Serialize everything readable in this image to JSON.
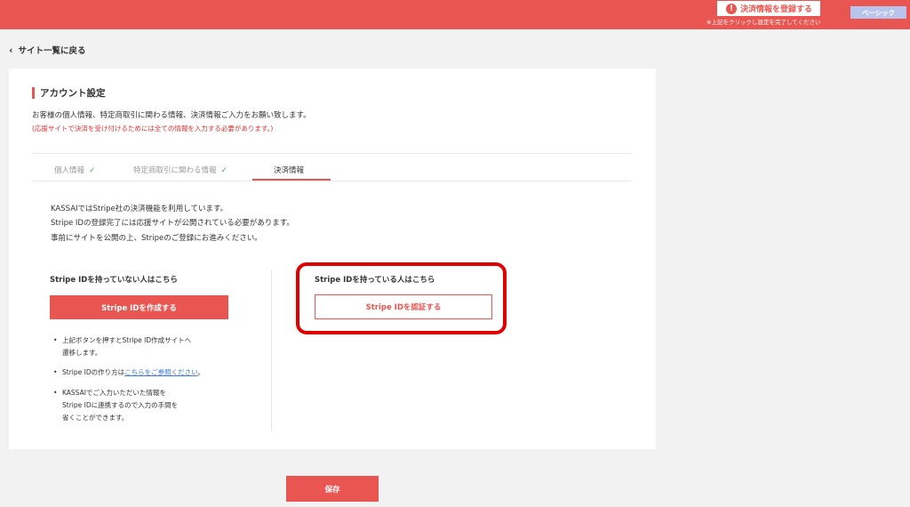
{
  "header": {
    "register_label": "決済情報を登録する",
    "register_note": "※上記をクリックし設定を完了してください",
    "plan_badge": "ベーシック"
  },
  "nav": {
    "back_label": "サイト一覧に戻る"
  },
  "section": {
    "title": "アカウント設定",
    "intro": "お客様の個人情報、特定商取引に関わる情報、決済情報ご入力をお願い致します。",
    "note": "(応援サイトで決済を受け付けるためには全ての情報を入力する必要があります。)"
  },
  "tabs": [
    {
      "label": "個人情報",
      "done": "✓"
    },
    {
      "label": "特定商取引に関わる情報",
      "done": "✓"
    },
    {
      "label": "決済情報"
    }
  ],
  "description": [
    "KASSAIではStripe社の決済機能を利用しています。",
    "Stripe IDの登録完了には応援サイトが公開されている必要があります。",
    "事前にサイトを公開の上、Stripeのご登録にお進みください。"
  ],
  "left_col": {
    "heading": "Stripe IDを持っていない人はこちら",
    "button": "Stripe IDを作成する",
    "bullets": {
      "b1_line1": "上記ボタンを押すとStripe ID作成サイトへ",
      "b1_line2": "遷移します。",
      "b2_prefix": "Stripe IDの作り方は",
      "b2_link": "こちらをご参照ください",
      "b2_suffix": "。",
      "b3_line1": "KASSAIでご入力いただいた情報を",
      "b3_line2": "Stripe IDに連携するので入力の手間を",
      "b3_line3": "省くことができます。"
    }
  },
  "right_col": {
    "heading": "Stripe IDを持っている人はこちら",
    "button": "Stripe IDを認証する"
  },
  "footer": {
    "save_label": "保存"
  },
  "colors": {
    "accent": "#e95551",
    "highlight": "#e00000",
    "link": "#3a7bd5"
  }
}
